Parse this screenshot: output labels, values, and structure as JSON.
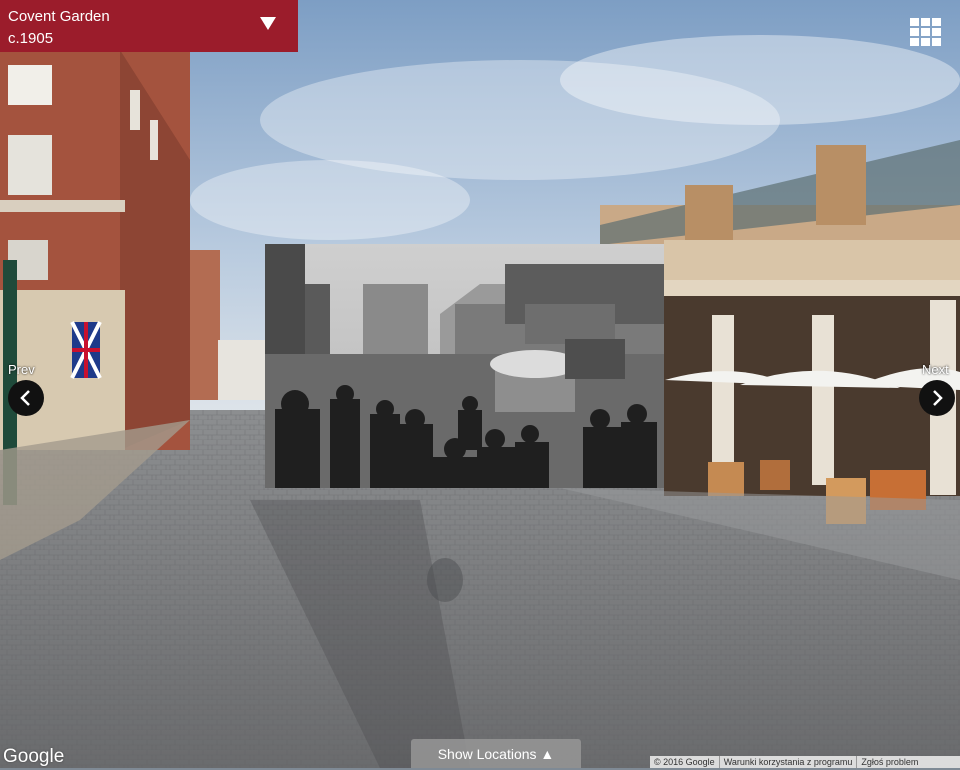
{
  "header": {
    "location": "Covent Garden",
    "date": "c.1905"
  },
  "nav": {
    "prev_label": "Prev",
    "next_label": "Next"
  },
  "bottom": {
    "show_locations_label": "Show Locations ▲"
  },
  "branding": {
    "logo_text": "Google"
  },
  "footer": {
    "copyright": "© 2016 Google",
    "terms": "Warunki korzystania z programu",
    "report": "Zgłoś problem"
  },
  "icons": {
    "title_toggle": "triangle-down-icon",
    "grid_menu": "grid-icon",
    "prev": "chevron-left-icon",
    "next": "chevron-right-icon"
  },
  "colors": {
    "title_panel": "#9b1c2b",
    "nav_button": "#111111",
    "show_locations": "#969696"
  }
}
